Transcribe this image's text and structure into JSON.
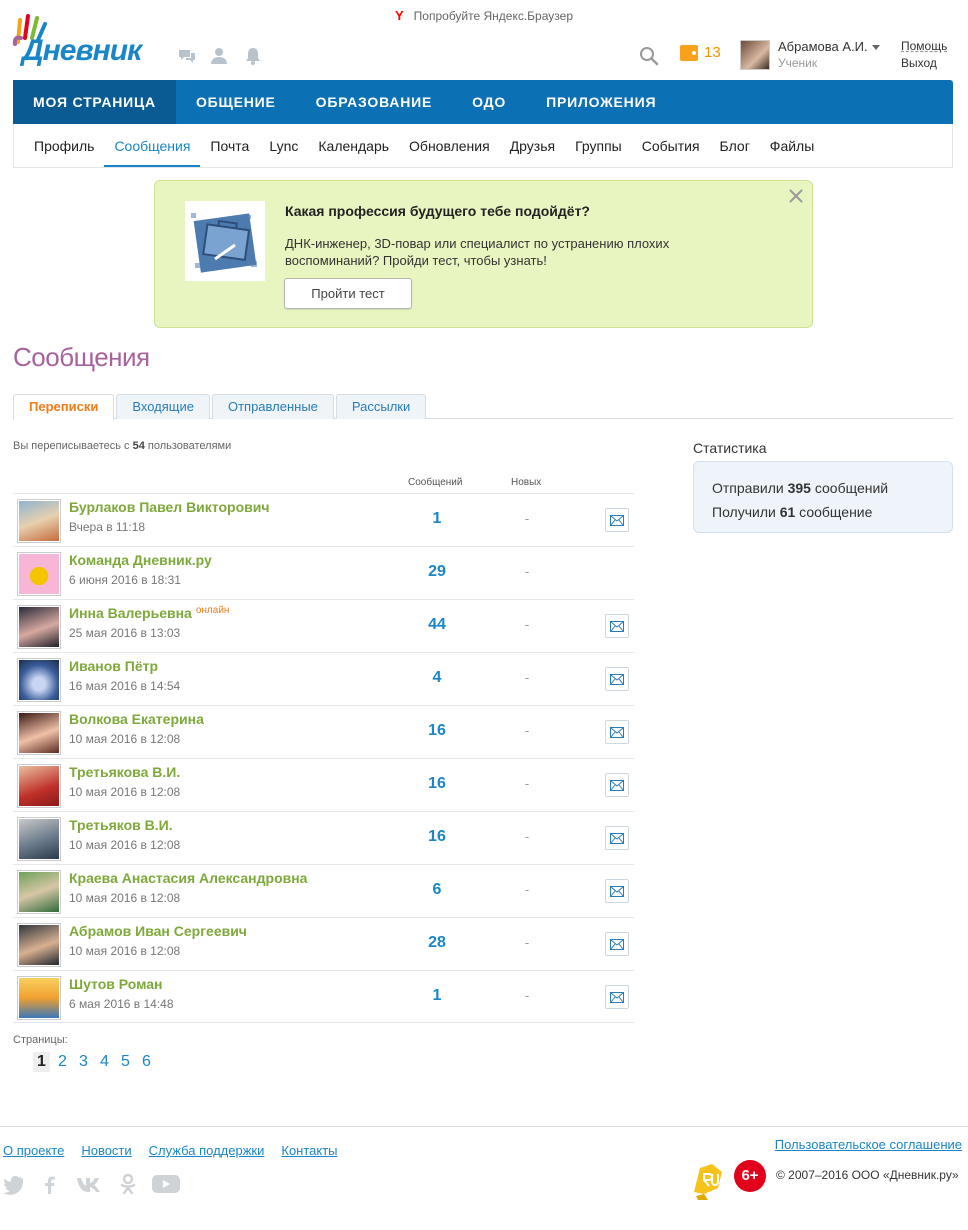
{
  "promo": {
    "text": "Попробуйте Яндекс.Браузер"
  },
  "header": {
    "brand": "Дневник",
    "wallet_count": "13",
    "user_name": "Абрамова А.И.",
    "user_role": "Ученик",
    "help": "Помощь",
    "logout": "Выход"
  },
  "main_nav": [
    "МОЯ СТРАНИЦА",
    "ОБЩЕНИЕ",
    "ОБРАЗОВАНИЕ",
    "ОДО",
    "ПРИЛОЖЕНИЯ"
  ],
  "sub_nav": [
    "Профиль",
    "Сообщения",
    "Почта",
    "Lync",
    "Календарь",
    "Обновления",
    "Друзья",
    "Группы",
    "События",
    "Блог",
    "Файлы"
  ],
  "banner": {
    "title": "Какая профессия будущего тебе подойдёт?",
    "text": "ДНК-инженер, 3D-повар или специалист по устранению плохих воспоминаний? Пройди тест, чтобы узнать!",
    "button": "Пройти тест"
  },
  "page_title": "Сообщения",
  "tabs": [
    "Переписки",
    "Входящие",
    "Отправленные",
    "Рассылки"
  ],
  "info": {
    "prefix": "Вы переписываетесь с ",
    "count": "54",
    "suffix": " пользователями"
  },
  "columns": {
    "messages": "Сообщений",
    "new": "Новых"
  },
  "online_label": "онлайн",
  "conversations": [
    {
      "name": "Бурлаков Павел Викторович",
      "date": "Вчера в 11:18",
      "count": "1",
      "new": "-",
      "online": false,
      "reply": true
    },
    {
      "name": "Команда Дневник.ру",
      "date": "6 июня 2016 в 18:31",
      "count": "29",
      "new": "-",
      "online": false,
      "reply": false
    },
    {
      "name": "Инна Валерьевна",
      "date": "25 мая 2016 в 13:03",
      "count": "44",
      "new": "-",
      "online": true,
      "reply": true
    },
    {
      "name": "Иванов Пётр",
      "date": "16 мая 2016 в 14:54",
      "count": "4",
      "new": "-",
      "online": false,
      "reply": true
    },
    {
      "name": "Волкова Екатерина",
      "date": "10 мая 2016 в 12:08",
      "count": "16",
      "new": "-",
      "online": false,
      "reply": true
    },
    {
      "name": "Третьякова В.И.",
      "date": "10 мая 2016 в 12:08",
      "count": "16",
      "new": "-",
      "online": false,
      "reply": true
    },
    {
      "name": "Третьяков В.И.",
      "date": "10 мая 2016 в 12:08",
      "count": "16",
      "new": "-",
      "online": false,
      "reply": true
    },
    {
      "name": "Краева Анастасия Александровна",
      "date": "10 мая 2016 в 12:08",
      "count": "6",
      "new": "-",
      "online": false,
      "reply": true
    },
    {
      "name": "Абрамов Иван Сергеевич",
      "date": "10 мая 2016 в 12:08",
      "count": "28",
      "new": "-",
      "online": false,
      "reply": true
    },
    {
      "name": "Шутов Роман",
      "date": "6 мая 2016 в 14:48",
      "count": "1",
      "new": "-",
      "online": false,
      "reply": true
    }
  ],
  "pagination": {
    "label": "Страницы:",
    "pages": [
      "1",
      "2",
      "3",
      "4",
      "5",
      "6"
    ],
    "current": "1"
  },
  "stats": {
    "title": "Статистика",
    "sent_prefix": "Отправили ",
    "sent_count": "395",
    "sent_suffix": " сообщений",
    "received_prefix": "Получили ",
    "received_count": "61",
    "received_suffix": " сообщение"
  },
  "footer": {
    "links": [
      "О проекте",
      "Новости",
      "Служба поддержки",
      "Контакты"
    ],
    "agreement": "Пользовательское соглашение",
    "age": "6+",
    "copyright": "© 2007–2016 ООО «Дневник.ру»",
    "social": [
      "twitter-icon",
      "facebook-icon",
      "vk-icon",
      "odnoklassniki-icon",
      "youtube-icon"
    ]
  },
  "colors": {
    "nav": "#0c70b4",
    "accent": "#1a86c7",
    "name_green": "#7fa83a",
    "title": "#a8629e",
    "orange": "#f07c1a"
  }
}
